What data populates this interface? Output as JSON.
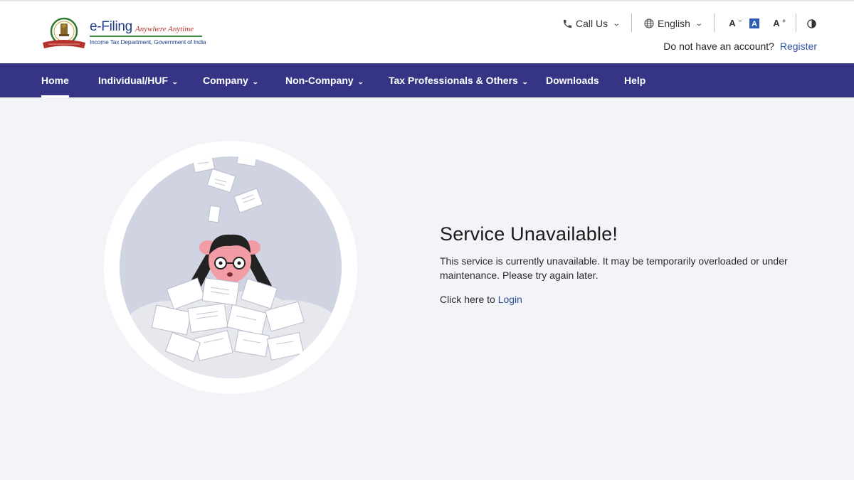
{
  "brand": {
    "title": "e-Filing",
    "tagline": "Anywhere Anytime",
    "subtitle": "Income Tax Department, Government of India"
  },
  "header": {
    "call_label": "Call Us",
    "language": "English",
    "font_decrease": "A",
    "font_default": "A",
    "font_increase": "A",
    "account_prompt": "Do not have an account?",
    "register_label": "Register"
  },
  "nav": {
    "items": [
      {
        "label": "Home",
        "active": true
      },
      {
        "label": "Individual/HUF"
      },
      {
        "label": "Company"
      },
      {
        "label": "Non-Company"
      },
      {
        "label": "Tax Professionals & Others"
      },
      {
        "label": "Downloads"
      },
      {
        "label": "Help"
      }
    ]
  },
  "message": {
    "title": "Service Unavailable!",
    "body": "This service is currently unavailable. It may be temporarily overloaded or under maintenance. Please try again later.",
    "login_prefix": "Click here to ",
    "login_link": "Login"
  },
  "colors": {
    "nav_bg": "#363585",
    "link": "#2d55a8",
    "page_bg": "#f3f4f8"
  },
  "icons": [
    "emblem-logo",
    "phone-icon",
    "globe-icon",
    "chevron-down-icon",
    "contrast-icon"
  ]
}
